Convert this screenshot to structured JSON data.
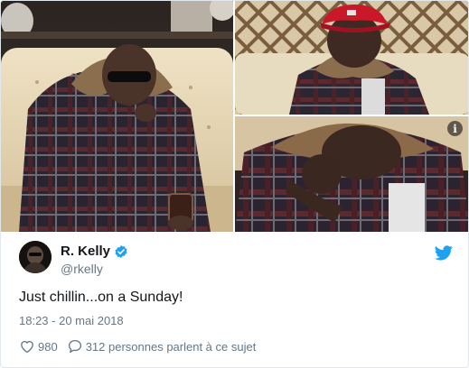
{
  "tweet": {
    "display_name": "R. Kelly",
    "handle": "@rkelly",
    "text": "Just chillin...on a Sunday!",
    "timestamp": "18:23 - 20 mai 2018",
    "likes": "980",
    "replies_text": "312 personnes parlent à ce sujet"
  },
  "icons": {
    "info": "info-icon",
    "verified": "verified-badge-icon",
    "brand": "twitter-bird-icon",
    "like": "heart-icon",
    "reply": "speech-bubble-icon"
  },
  "colors": {
    "brand_blue": "#1da1f2",
    "text_primary": "#14171a",
    "text_secondary": "#657786",
    "border": "#e1e8ed"
  }
}
